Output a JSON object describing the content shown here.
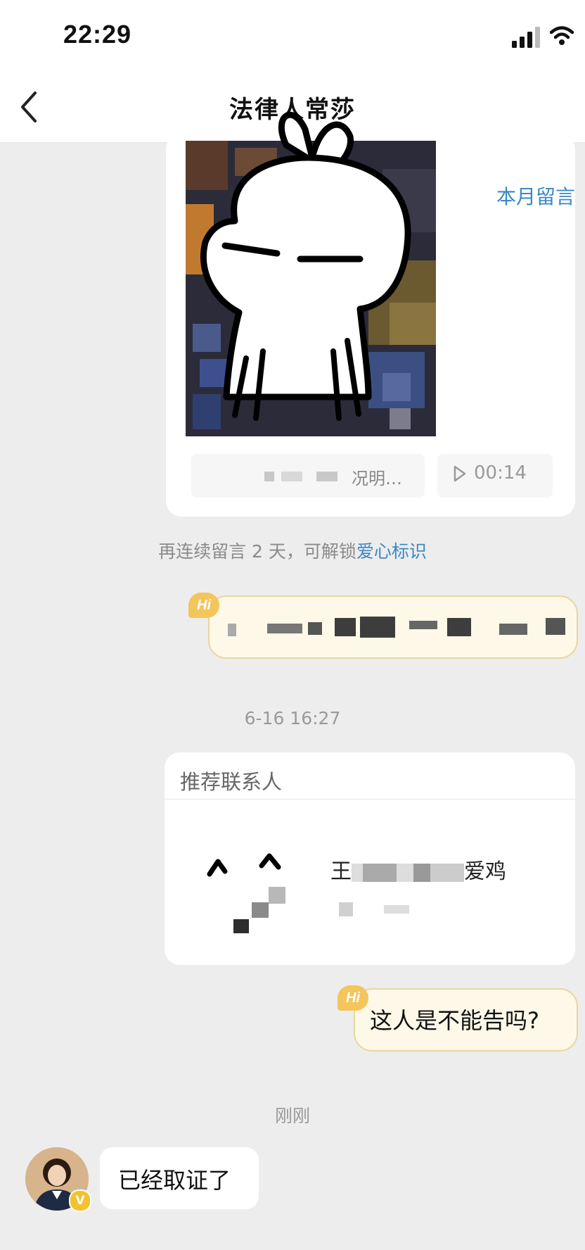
{
  "status_bar": {
    "time": "22:29"
  },
  "header": {
    "title": "法律人常莎",
    "back_icon": "chevron-left-icon"
  },
  "messages": {
    "card": {
      "month_link": "本月留言",
      "preview_text": "况明…",
      "audio_duration": "00:14"
    },
    "unlock_hint": {
      "text": "再连续留言 2 天，可解锁",
      "link": "爱心标识"
    },
    "hi_badge": "Hi",
    "timestamp_1": "6-16 16:27",
    "recommended_contact": {
      "header": "推荐联系人",
      "name_start": "王",
      "name_end": "爱鸡"
    },
    "question": "这人是不能告吗?",
    "timestamp_2": "刚刚",
    "reply": {
      "text": "已经取证了",
      "badge": "V"
    }
  },
  "colors": {
    "link": "#3b88c4",
    "hi_badge": "#f3c55b",
    "hi_bubble": "#fdf8e8",
    "background": "#ededed"
  }
}
